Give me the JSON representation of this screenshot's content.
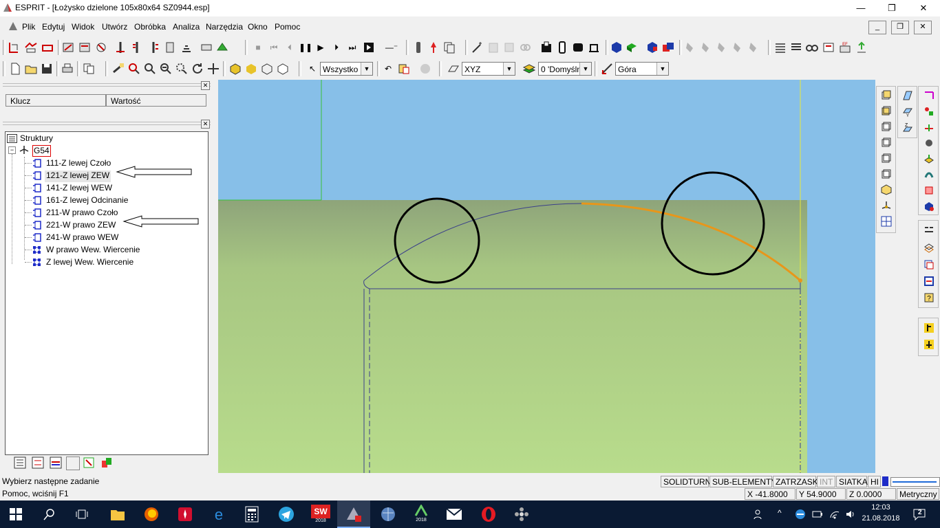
{
  "window": {
    "title": "ESPRIT - [Łożysko dzielone 105x80x64 SZ0944.esp]",
    "minimize": "—",
    "restore": "❐",
    "close": "✕"
  },
  "menu": {
    "items": [
      "Plik",
      "Edytuj",
      "Widok",
      "Utwórz",
      "Obróbka",
      "Analiza",
      "Narzędzia",
      "Okno",
      "Pomoc"
    ],
    "mdi_min": "_",
    "mdi_restore": "❐",
    "mdi_close": "✕"
  },
  "toolbar": {
    "select_filter": "Wszystko",
    "plane": "XYZ",
    "layer": "0 'Domyśln",
    "view": "Góra"
  },
  "properties_panel": {
    "col_key": "Klucz",
    "col_value": "Wartość"
  },
  "tree": {
    "root": "Struktury",
    "wcs": "G54",
    "operations": [
      {
        "label": "111-Z lewej Czoło",
        "icon": "turning-op-icon"
      },
      {
        "label": "121-Z lewej ZEW",
        "icon": "turning-op-icon",
        "highlighted": true
      },
      {
        "label": "141-Z lewej WEW",
        "icon": "turning-op-icon"
      },
      {
        "label": "161-Z lewej Odcinanie",
        "icon": "turning-op-icon"
      },
      {
        "label": "211-W prawo Czoło",
        "icon": "turning-op-icon"
      },
      {
        "label": "221-W prawo ZEW",
        "icon": "turning-op-icon"
      },
      {
        "label": "241-W prawo WEW",
        "icon": "turning-op-icon"
      },
      {
        "label": "W prawo Wew. Wiercenie",
        "icon": "drilling-op-icon"
      },
      {
        "label": "Z lewej Wew. Wiercenie",
        "icon": "drilling-op-icon"
      }
    ]
  },
  "status": {
    "prompt": "Wybierz następne zadanie",
    "help": "Pomoc, wciśnij F1",
    "modes": [
      "SOLIDTURN",
      "SUB-ELEMENTY",
      "ZATRZASK",
      "INT",
      "SIATKA",
      "HI"
    ],
    "x": "X -41.8000",
    "y": "Y 54.9000",
    "z": "Z 0.0000",
    "units": "Metryczny"
  },
  "taskbar": {
    "time": "12:03",
    "date": "21.08.2018",
    "notifications": "2",
    "apps": [
      "file-explorer-icon",
      "firefox-icon",
      "huawei-icon",
      "edge-icon",
      "calculator-icon",
      "telegram-icon",
      "solidworks-icon",
      "esprit-icon",
      "globe-icon",
      "catia-icon",
      "mail-icon",
      "opera-icon",
      "dots-icon"
    ],
    "sw_badge": "2018",
    "catia_badge": "2018"
  },
  "colors": {
    "viewport_bg": "#87bfe8",
    "stock": "#b5d98a",
    "toolpath": "#e8961a",
    "profile": "#3a3f8a"
  }
}
